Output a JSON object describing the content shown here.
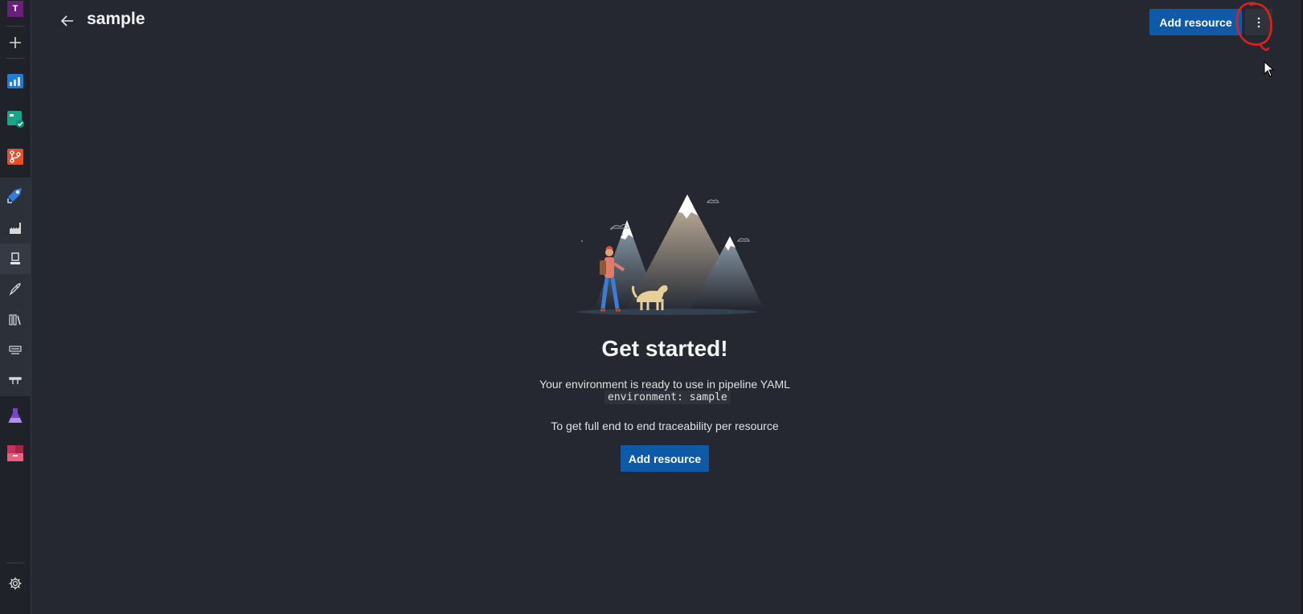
{
  "rail": {
    "org_initial": "T",
    "items": [
      {
        "icon": "plus-icon"
      },
      {
        "icon": "overview-icon",
        "color": "#1e7bd8"
      },
      {
        "icon": "boards-icon",
        "color": "#18a58a"
      },
      {
        "icon": "repos-icon",
        "color": "#e2512c"
      },
      {
        "icon": "pipelines-icon",
        "color": "#2f7de0"
      },
      {
        "icon": "builds-icon"
      },
      {
        "icon": "environments-icon"
      },
      {
        "icon": "releases-icon"
      },
      {
        "icon": "library-icon"
      },
      {
        "icon": "task-groups-icon"
      },
      {
        "icon": "deployment-groups-icon"
      },
      {
        "icon": "test-plans-icon",
        "color": "#7a44c9"
      },
      {
        "icon": "artifacts-icon",
        "color": "#c9305a"
      }
    ],
    "settings_icon": "gear-icon"
  },
  "header": {
    "title": "sample",
    "add_resource_label": "Add resource",
    "more_icon": "more-vertical-icon"
  },
  "empty_state": {
    "title": "Get started!",
    "line1": "Your environment is ready to use in pipeline YAML",
    "code": "environment: sample",
    "line2": "To get full end to end traceability per resource",
    "button_label": "Add resource"
  },
  "colors": {
    "accent": "#0f5aa8",
    "background": "#252830",
    "annotation": "#e0201c"
  }
}
